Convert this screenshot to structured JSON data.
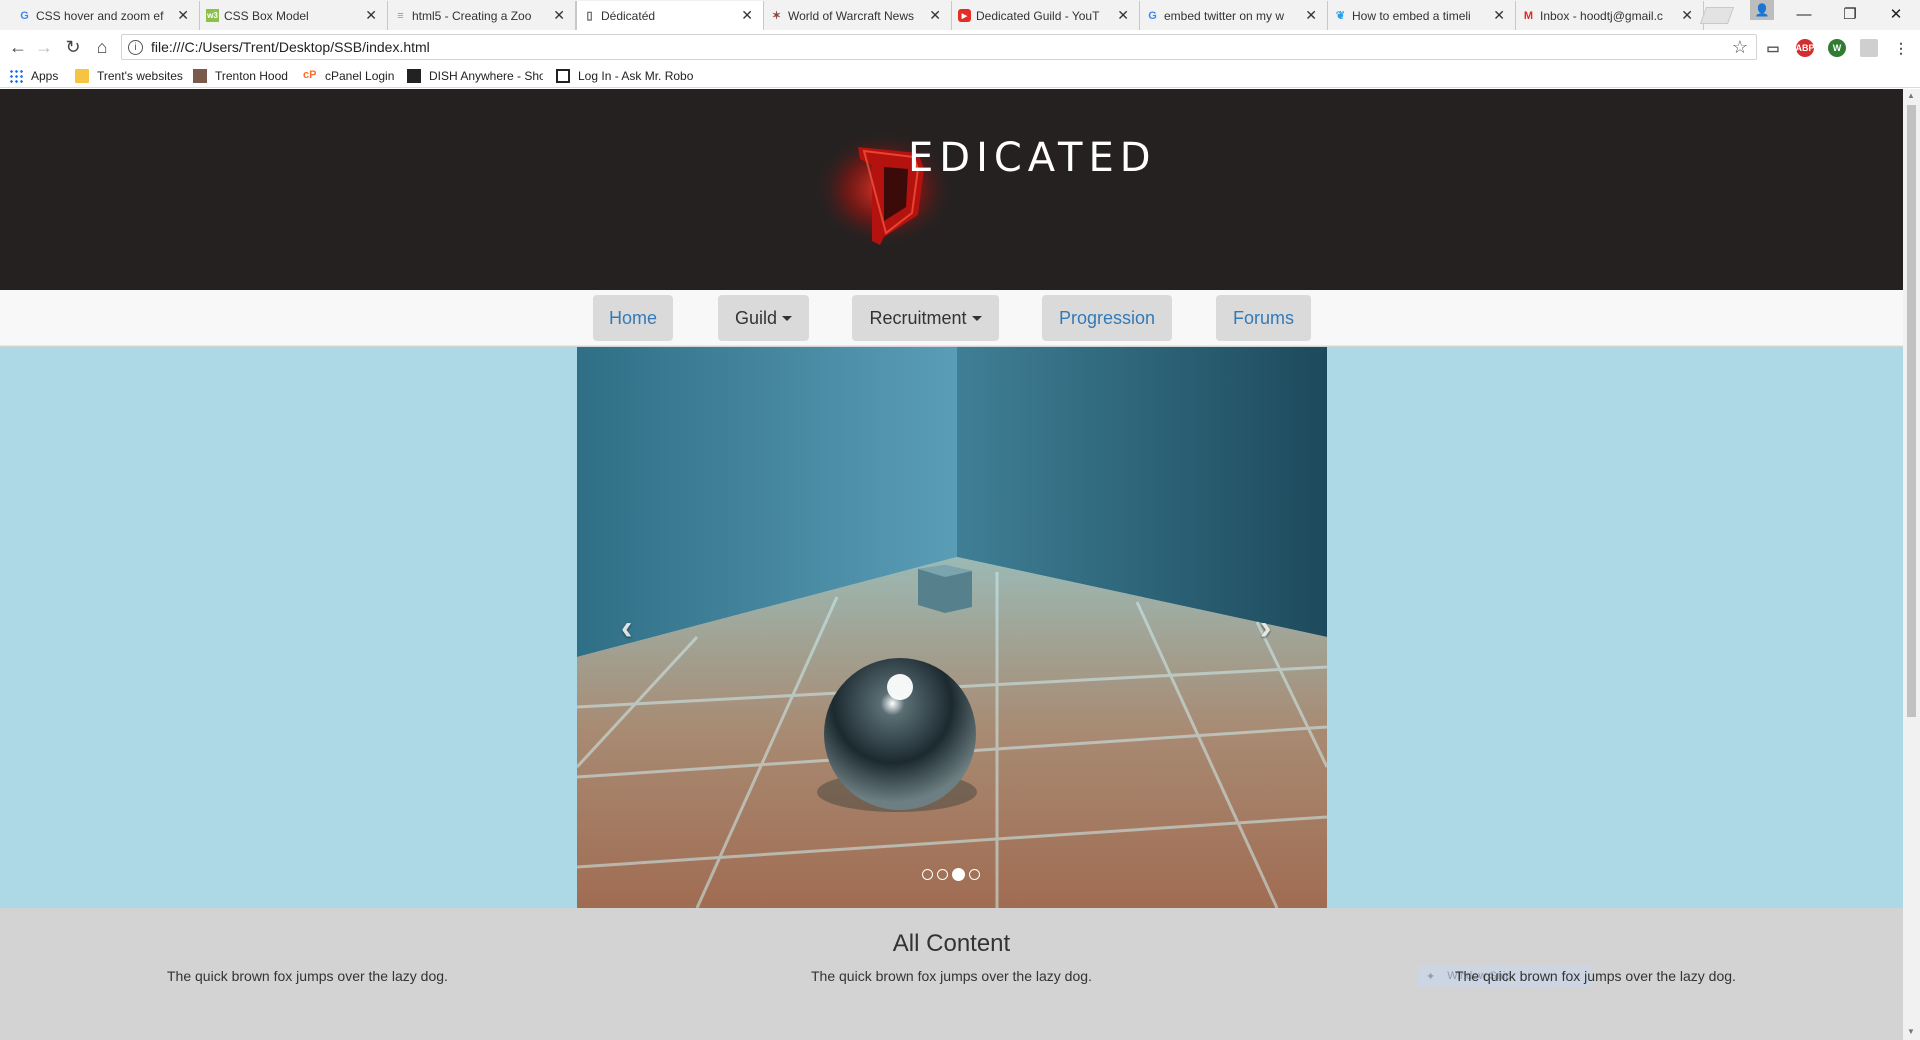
{
  "browser": {
    "tabs": [
      {
        "title": "CSS hover and zoom ef",
        "favicon": "google-icon",
        "active": false
      },
      {
        "title": "CSS Box Model",
        "favicon": "w3schools-icon",
        "active": false
      },
      {
        "title": "html5 - Creating a Zoo",
        "favicon": "stackoverflow-icon",
        "active": false
      },
      {
        "title": "Dédicatéd",
        "favicon": "page-icon",
        "active": true
      },
      {
        "title": "World of Warcraft News",
        "favicon": "wow-icon",
        "active": false
      },
      {
        "title": "Dedicated Guild - YouT",
        "favicon": "youtube-icon",
        "active": false
      },
      {
        "title": "embed twitter on my w",
        "favicon": "google-icon",
        "active": false
      },
      {
        "title": "How to embed a timeli",
        "favicon": "twitter-icon",
        "active": false
      },
      {
        "title": "Inbox - hoodtj@gmail.c",
        "favicon": "gmail-icon",
        "active": false
      }
    ],
    "url": "file:///C:/Users/Trent/Desktop/SSB/index.html",
    "bookmarks": [
      "Apps",
      "Trent's websites",
      "Trenton Hood",
      "cPanel Login",
      "DISH Anywhere - Sho",
      "Log In - Ask Mr. Robo"
    ],
    "extensions": [
      "cast-icon",
      "adblock-icon",
      "w-extension-icon",
      "extension-icon",
      "menu-icon"
    ]
  },
  "page": {
    "logo_text": "EDICATED",
    "nav": [
      {
        "label": "Home",
        "type": "link"
      },
      {
        "label": "Guild",
        "type": "dropdown"
      },
      {
        "label": "Recruitment",
        "type": "dropdown"
      },
      {
        "label": "Progression",
        "type": "link"
      },
      {
        "label": "Forums",
        "type": "link"
      }
    ],
    "carousel": {
      "prev_icon": "chevron-left-icon",
      "next_icon": "chevron-right-icon",
      "slide_count": 4,
      "active_slide": 3
    },
    "content": {
      "title": "All Content",
      "columns": [
        "The quick brown fox jumps over the lazy dog.",
        "The quick brown fox jumps over the lazy dog.",
        "The quick brown fox jumps over the lazy dog."
      ],
      "overlay_text": "Window Snip"
    }
  },
  "colors": {
    "header_bg": "#262121",
    "hero_bg": "#add8e6",
    "content_bg": "#d3d3d3",
    "nav_link": "#337ab7",
    "logo_red": "#c41a1a"
  }
}
